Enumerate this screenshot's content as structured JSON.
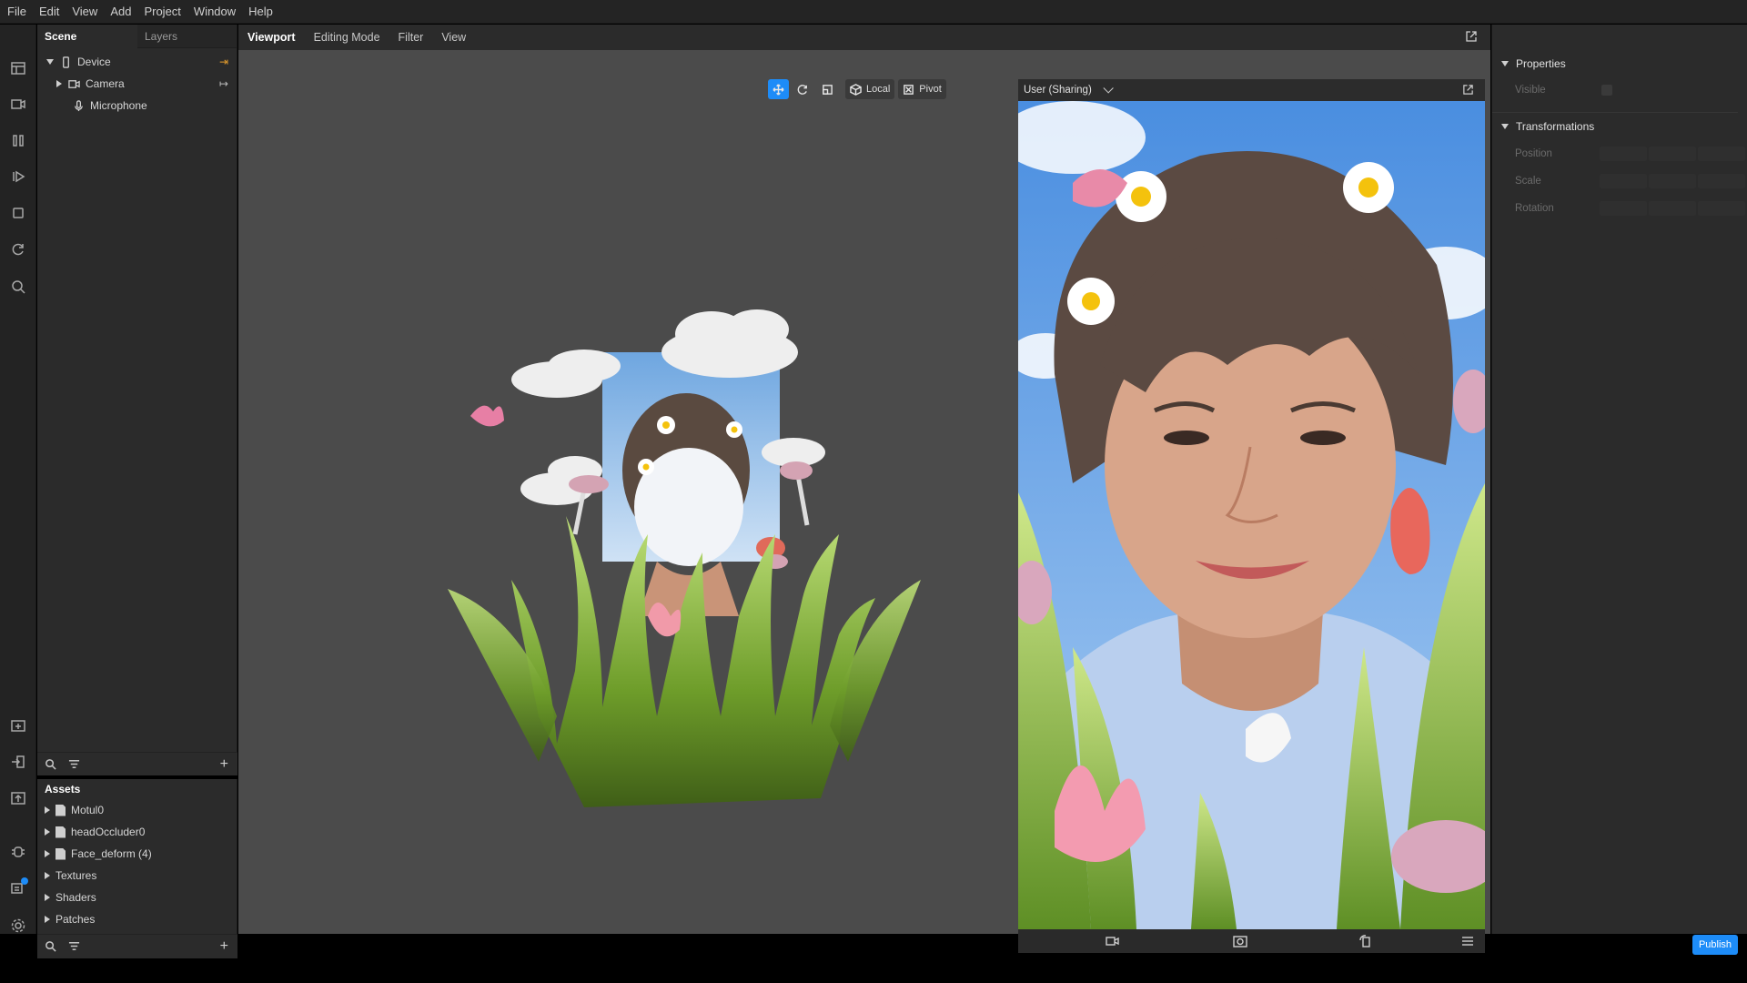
{
  "menu": [
    "File",
    "Edit",
    "View",
    "Add",
    "Project",
    "Window",
    "Help"
  ],
  "scene_panel": {
    "tabs": [
      "Scene",
      "Layers"
    ],
    "items": [
      {
        "label": "Device",
        "action": "⇥"
      },
      {
        "label": "Camera",
        "action": "↦"
      },
      {
        "label": "Microphone"
      }
    ]
  },
  "assets_panel": {
    "title": "Assets",
    "items": [
      "Motul0",
      "headOccluder0",
      "Face_deform (4)",
      "Textures",
      "Shaders",
      "Patches"
    ]
  },
  "viewport": {
    "tabs": [
      "Viewport",
      "Editing Mode",
      "Filter",
      "View"
    ],
    "tools": {
      "local": "Local",
      "pivot": "Pivot"
    }
  },
  "preview": {
    "source": "User (Sharing)"
  },
  "properties": {
    "title": "Properties",
    "visible_label": "Visible",
    "transformations_title": "Transformations",
    "position_label": "Position",
    "scale_label": "Scale",
    "rotation_label": "Rotation"
  },
  "publish_label": "Publish",
  "colors": {
    "accent": "#1d8cf8",
    "orange": "#e09a2c"
  }
}
